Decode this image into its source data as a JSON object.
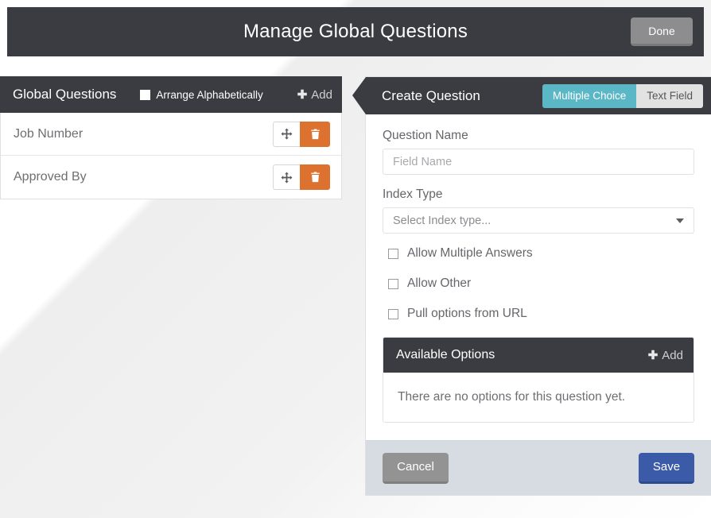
{
  "topbar": {
    "title": "Manage Global Questions",
    "done_label": "Done"
  },
  "left_panel": {
    "header_title": "Global Questions",
    "arrange_label": "Arrange Alphabetically",
    "arrange_checked": false,
    "add_label": "Add",
    "add_icon": "plus-icon",
    "questions": [
      {
        "name": "Job Number",
        "drag_icon": "move-arrows-icon",
        "delete_icon": "trash-icon"
      },
      {
        "name": "Approved By",
        "drag_icon": "move-arrows-icon",
        "delete_icon": "trash-icon"
      }
    ]
  },
  "right_panel": {
    "header_title": "Create Question",
    "type_tabs": [
      {
        "label": "Multiple Choice",
        "active": true
      },
      {
        "label": "Text Field",
        "active": false
      }
    ],
    "question_name": {
      "label": "Question Name",
      "value": "",
      "placeholder": "Field Name"
    },
    "index_type": {
      "label": "Index Type",
      "selected": "Select Index type...",
      "caret_icon": "chevron-down-icon"
    },
    "checkboxes": [
      {
        "label": "Allow Multiple Answers",
        "checked": false
      },
      {
        "label": "Allow Other",
        "checked": false
      },
      {
        "label": "Pull options from URL",
        "checked": false
      }
    ],
    "available_options": {
      "title": "Available Options",
      "add_label": "Add",
      "add_icon": "plus-icon",
      "empty_text": "There are no options for this question yet."
    },
    "footer": {
      "cancel_label": "Cancel",
      "save_label": "Save"
    }
  },
  "colors": {
    "dark_header": "#3b3b42",
    "accent_teal": "#5bb7c6",
    "delete_orange": "#dd7230",
    "save_blue": "#3b5ba8",
    "footer_bg": "#d6dce2"
  }
}
